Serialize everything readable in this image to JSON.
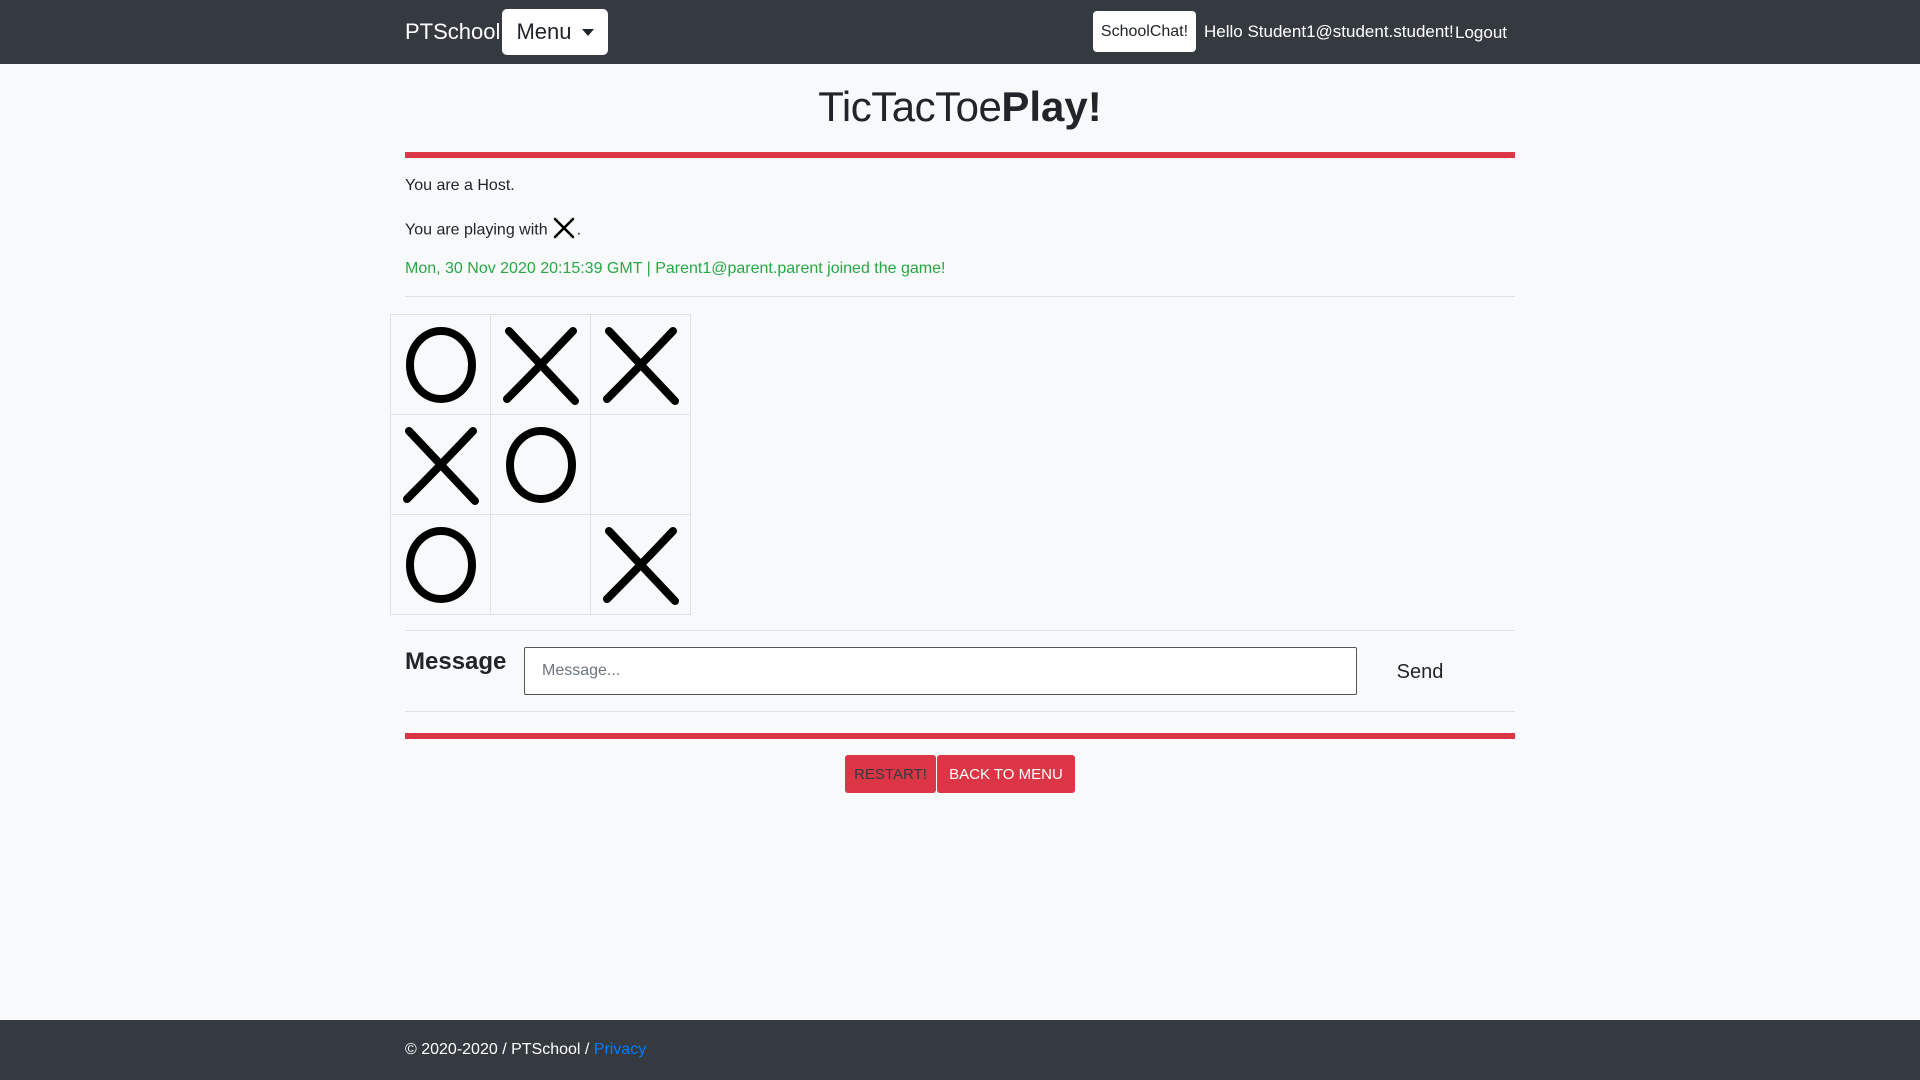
{
  "navbar": {
    "brand": "PTSchool",
    "menu_label": "Menu",
    "chat_label": "SchoolChat!",
    "greeting": "Hello Student1@student.student!",
    "logout_label": "Logout"
  },
  "page": {
    "title_part1": "TicTacToe",
    "title_part2": "Play!",
    "role_text": "You are a Host.",
    "playing_with_prefix": "You are playing with",
    "playing_with_mark": "X",
    "playing_with_suffix": ".",
    "event_message": "Mon, 30 Nov 2020 20:15:39 GMT | Parent1@parent.parent joined the game!"
  },
  "board": {
    "cells": [
      "O",
      "X",
      "X",
      "X",
      "O",
      "",
      "O",
      "",
      "X"
    ]
  },
  "chat": {
    "label": "Message",
    "input_value": "",
    "input_placeholder": "Message...",
    "send_label": "Send"
  },
  "actions": {
    "restart_label": "RESTART!",
    "back_label": "BACK TO MENU"
  },
  "footer": {
    "copyright": "© 2020-2020 / PTSchool /",
    "privacy_label": "Privacy"
  },
  "colors": {
    "navbar_bg": "#343a40",
    "accent_red": "#dc3545",
    "success_green": "#28a745",
    "link_blue": "#007bff"
  }
}
